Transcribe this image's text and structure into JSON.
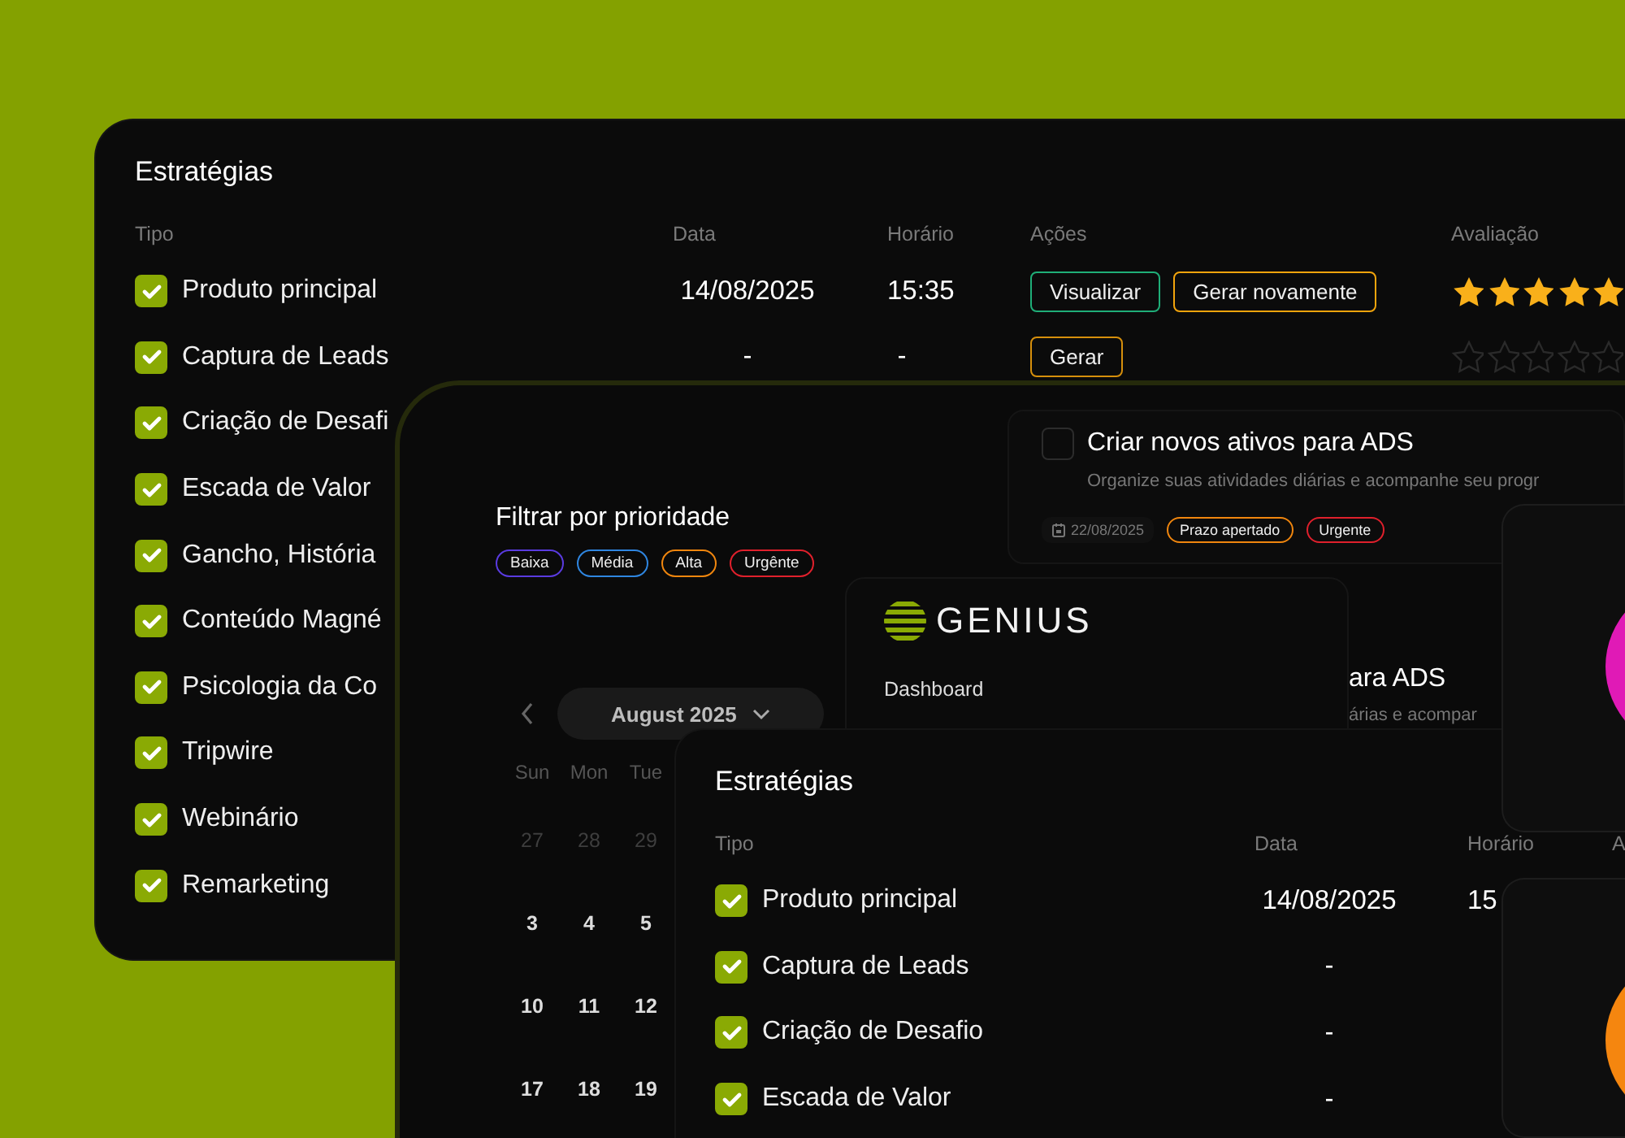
{
  "back_table": {
    "title": "Estratégias",
    "columns": [
      "Tipo",
      "Data",
      "Horário",
      "Ações",
      "Avaliação"
    ],
    "rows": [
      {
        "type": "Produto principal",
        "checked": true,
        "date": "14/08/2025",
        "time": "15:35",
        "actions": [
          {
            "label": "Visualizar",
            "color": "#1fae78"
          },
          {
            "label": "Gerar novamente",
            "color": "#f2a40c"
          }
        ],
        "stars": 5
      },
      {
        "type": "Captura de Leads",
        "checked": true,
        "date": "-",
        "time": "-",
        "actions": [
          {
            "label": "Gerar",
            "color": "#d68f0c"
          }
        ],
        "stars": 0
      },
      {
        "type": "Criação de Desafi",
        "checked": true
      },
      {
        "type": "Escada de Valor",
        "checked": true
      },
      {
        "type": "Gancho, História",
        "checked": true
      },
      {
        "type": "Conteúdo Magné",
        "checked": true
      },
      {
        "type": "Psicologia da Co",
        "checked": true
      },
      {
        "type": "Tripwire",
        "checked": true
      },
      {
        "type": "Webinário",
        "checked": true
      },
      {
        "type": "Remarketing",
        "checked": true
      }
    ]
  },
  "priority_filter": {
    "title": "Filtrar por prioridade",
    "chips": [
      {
        "label": "Baixa",
        "color": "#5a3be0"
      },
      {
        "label": "Média",
        "color": "#2f86e0"
      },
      {
        "label": "Alta",
        "color": "#f0860e"
      },
      {
        "label": "Urgênte",
        "color": "#e0202c"
      }
    ]
  },
  "calendar": {
    "month": "August 2025",
    "weekdays": [
      "Sun",
      "Mon",
      "Tue"
    ],
    "weeks": [
      [
        {
          "day": "27",
          "outside": true
        },
        {
          "day": "28",
          "outside": true
        },
        {
          "day": "29",
          "outside": true
        }
      ],
      [
        {
          "day": "3",
          "outside": false
        },
        {
          "day": "4",
          "outside": false
        },
        {
          "day": "5",
          "outside": false
        }
      ],
      [
        {
          "day": "10",
          "outside": false
        },
        {
          "day": "11",
          "outside": false
        },
        {
          "day": "12",
          "outside": false
        }
      ],
      [
        {
          "day": "17",
          "outside": false
        },
        {
          "day": "18",
          "outside": false
        },
        {
          "day": "19",
          "outside": false
        }
      ]
    ]
  },
  "task_cards": [
    {
      "title": "Criar novos ativos para ADS",
      "description": "Organize suas atividades diárias e acompanhe seu progr",
      "checked": false,
      "date": "22/08/2025",
      "tags": [
        {
          "label": "Prazo apertado",
          "color": "#f0860e"
        },
        {
          "label": "Urgente",
          "color": "#e0202c"
        }
      ]
    },
    {
      "title": "ara ADS",
      "description": "árias e acompar"
    }
  ],
  "brand": {
    "name": "GENIUS",
    "nav": [
      "Dashboard"
    ]
  },
  "front_table": {
    "title": "Estratégias",
    "columns": [
      "Tipo",
      "Data",
      "Horário",
      "A"
    ],
    "rows": [
      {
        "type": "Produto principal",
        "checked": true,
        "date": "14/08/2025",
        "time": "15"
      },
      {
        "type": "Captura de Leads",
        "checked": true,
        "date": "-"
      },
      {
        "type": "Criação de Desafio",
        "checked": true,
        "date": "-"
      },
      {
        "type": "Escada de Valor",
        "checked": true,
        "date": "-"
      }
    ]
  }
}
